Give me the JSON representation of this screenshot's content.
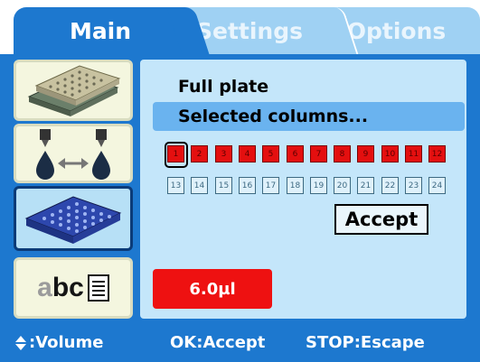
{
  "tabs": [
    {
      "label": "Main",
      "active": true
    },
    {
      "label": "Settings",
      "active": false
    },
    {
      "label": "Options",
      "active": false
    }
  ],
  "sidebar": {
    "icons": [
      {
        "name": "plates-icon",
        "selected": false
      },
      {
        "name": "dispense-transfer-icon",
        "selected": false
      },
      {
        "name": "plate-columns-icon",
        "selected": true
      },
      {
        "name": "abc-text-icon",
        "text": "abc",
        "selected": false
      }
    ]
  },
  "panel": {
    "option_full": "Full plate",
    "option_selected": "Selected columns...",
    "columns_row1": [
      "1",
      "2",
      "3",
      "4",
      "5",
      "6",
      "7",
      "8",
      "9",
      "10",
      "11",
      "12"
    ],
    "columns_row2": [
      "13",
      "14",
      "15",
      "16",
      "17",
      "18",
      "19",
      "20",
      "21",
      "22",
      "23",
      "24"
    ],
    "selected_column_count": 12,
    "accept_label": "Accept",
    "volume": "6.0µl"
  },
  "footer": {
    "volume_hint": ":Volume",
    "accept_hint": "OK:Accept",
    "escape_hint": "STOP:Escape"
  },
  "colors": {
    "background": "#1d78cf",
    "panel": "#c4e6fa",
    "selected_option": "#6ab3ef",
    "selected_cell": "#e40f0f",
    "inactive_tab": "#9fd1f3"
  }
}
